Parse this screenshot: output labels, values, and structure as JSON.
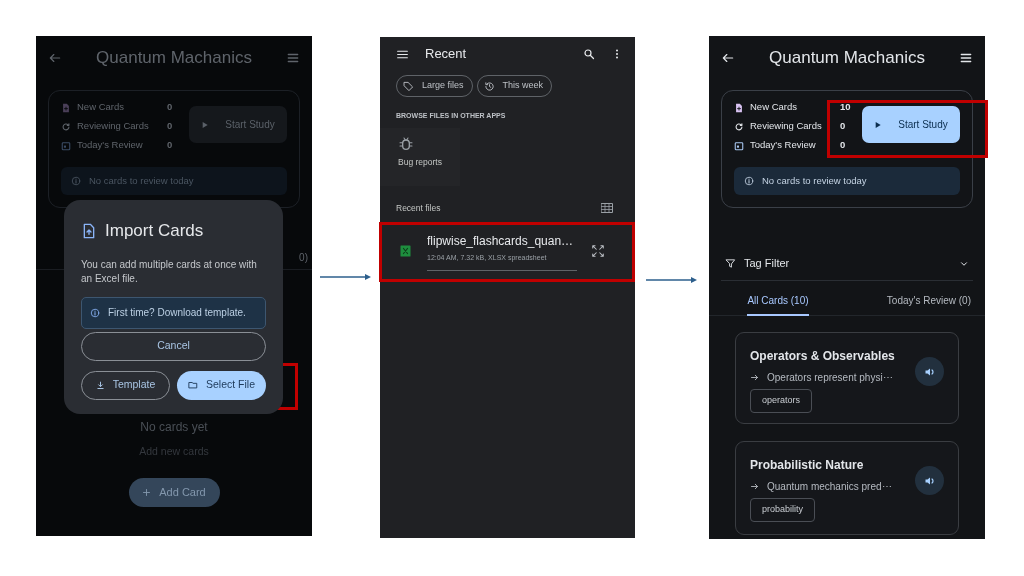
{
  "screens": [
    {
      "kind": "deck",
      "dimmed": true,
      "title": "Quantum Machanics",
      "stats": [
        {
          "kind": "new",
          "label": "New Cards",
          "value": "0"
        },
        {
          "kind": "reviewing",
          "label": "Reviewing Cards",
          "value": "0"
        },
        {
          "kind": "today",
          "label": "Today's Review",
          "value": "0"
        }
      ],
      "start_button": {
        "label": "Start Study",
        "disabled": true
      },
      "notice": "No cards to review today",
      "tab_fragment": "0)",
      "empty_state": {
        "title": "No cards yet",
        "subtitle": "Add new cards"
      },
      "add_button": "Add Card",
      "dialog": {
        "title": "Import Cards",
        "text": "You can add multiple cards at once with an Excel file.",
        "info": "First time? Download template.",
        "cancel": "Cancel",
        "buttons": [
          {
            "kind": "template",
            "label": "Template"
          },
          {
            "kind": "select",
            "label": "Select File",
            "highlighted": true
          }
        ]
      }
    },
    {
      "kind": "picker",
      "title": "Recent",
      "chips": [
        {
          "kind": "size",
          "label": "Large files"
        },
        {
          "kind": "recent",
          "label": "This week"
        }
      ],
      "section": "BROWSE FILES IN OTHER APPS",
      "apps": [
        {
          "label": "Bug reports"
        }
      ],
      "recent_label": "Recent files",
      "files": [
        {
          "name": "flipwise_flashcards_quan…",
          "meta": "12:04 AM, 7.32 kB, XLSX spreadsheet",
          "highlighted": true
        }
      ]
    },
    {
      "kind": "deck",
      "dimmed": false,
      "title": "Quantum Machanics",
      "stats": [
        {
          "kind": "new",
          "label": "New Cards",
          "value": "10"
        },
        {
          "kind": "reviewing",
          "label": "Reviewing Cards",
          "value": "0"
        },
        {
          "kind": "today",
          "label": "Today's Review",
          "value": "0"
        }
      ],
      "start_button": {
        "label": "Start Study",
        "disabled": false,
        "highlighted": true
      },
      "notice": "No cards to review today",
      "tag_filter": "Tag Filter",
      "tabs": [
        {
          "label": "All Cards (10)",
          "selected": true
        },
        {
          "label": "Today's Review (0)",
          "selected": false
        }
      ],
      "cards": [
        {
          "title": "Operators & Observables",
          "answer": "Operators represent physi⋯",
          "tag": "operators"
        },
        {
          "title": "Probabilistic Nature",
          "answer": "Quantum mechanics pred⋯",
          "tag": "probability"
        }
      ]
    }
  ]
}
